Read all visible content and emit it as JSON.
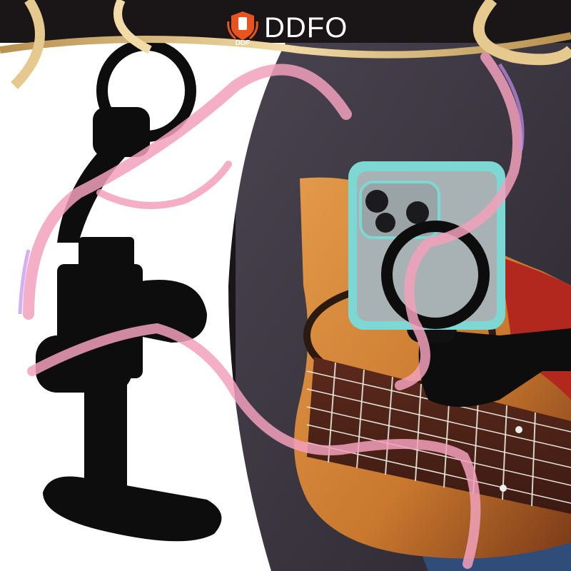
{
  "brand": {
    "name": "DDFO",
    "logo_text": "DDF"
  },
  "colors": {
    "brand_orange": "#e8531f",
    "ribbon_pink": "#f2a0bb",
    "ribbon_gold": "#e6c98f",
    "phone_case": "#7dd8d4",
    "guitar_wood": "#d98a3a",
    "holder_black": "#0d0d0d"
  },
  "icons": [
    "ddf-crest-logo"
  ]
}
